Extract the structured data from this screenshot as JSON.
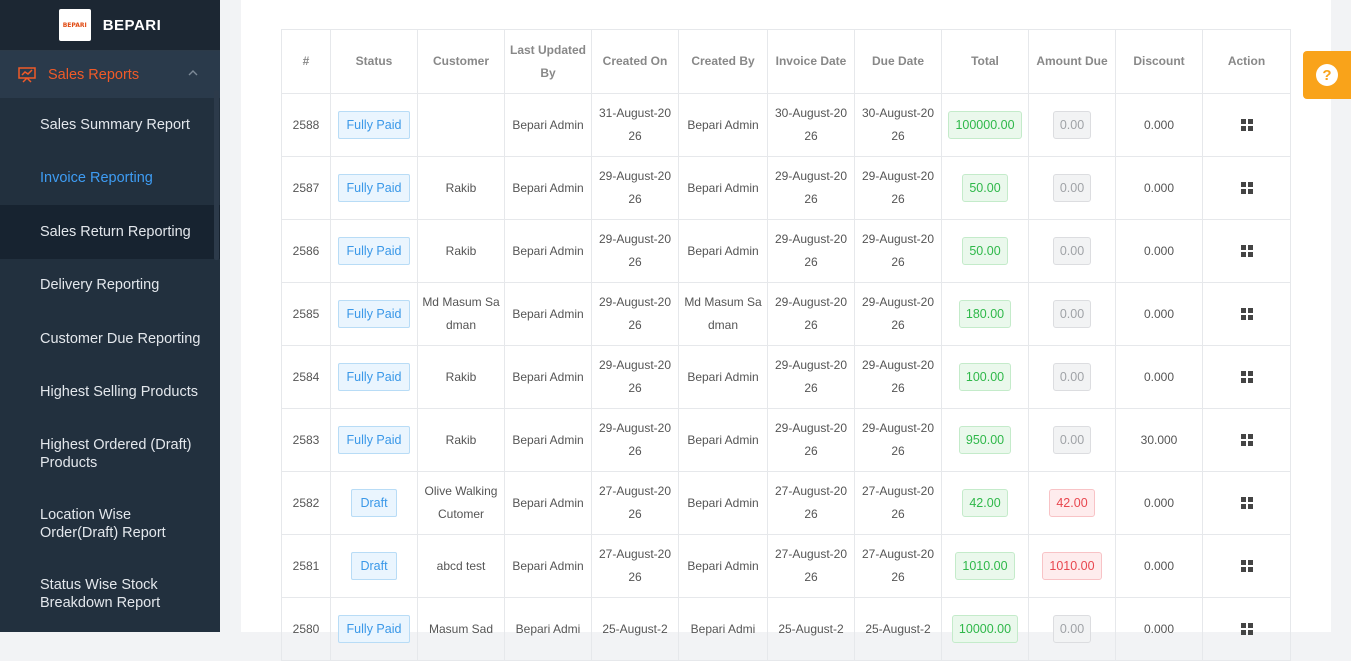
{
  "brand": {
    "name": "BEPARI",
    "logo_text": "BEPARI"
  },
  "sidebar": {
    "section_label": "Sales Reports",
    "items": [
      {
        "label": "Sales Summary Report"
      },
      {
        "label": "Invoice Reporting"
      },
      {
        "label": "Sales Return Reporting"
      },
      {
        "label": "Delivery Reporting"
      },
      {
        "label": "Customer Due Reporting"
      },
      {
        "label": "Highest Selling Products"
      },
      {
        "label": "Highest Ordered (Draft) Products"
      },
      {
        "label": "Location Wise Order(Draft) Report"
      },
      {
        "label": "Status Wise Stock Breakdown Report"
      }
    ]
  },
  "table": {
    "headers": [
      "#",
      "Status",
      "Customer",
      "Last Updated By",
      "Created On",
      "Created By",
      "Invoice Date",
      "Due Date",
      "Total",
      "Amount Due",
      "Discount",
      "Action"
    ],
    "rows": [
      {
        "id": "2588",
        "status": "Fully Paid",
        "customer": "",
        "last_updated_by": "Bepari Admin",
        "created_on": "31-August-2026",
        "created_by": "Bepari Admin",
        "invoice_date": "30-August-2026",
        "due_date": "30-August-2026",
        "total": "100000.00",
        "amount_due": "0.00",
        "due_state": "grey",
        "discount": "0.000"
      },
      {
        "id": "2587",
        "status": "Fully Paid",
        "customer": "Rakib",
        "last_updated_by": "Bepari Admin",
        "created_on": "29-August-2026",
        "created_by": "Bepari Admin",
        "invoice_date": "29-August-2026",
        "due_date": "29-August-2026",
        "total": "50.00",
        "amount_due": "0.00",
        "due_state": "grey",
        "discount": "0.000"
      },
      {
        "id": "2586",
        "status": "Fully Paid",
        "customer": "Rakib",
        "last_updated_by": "Bepari Admin",
        "created_on": "29-August-2026",
        "created_by": "Bepari Admin",
        "invoice_date": "29-August-2026",
        "due_date": "29-August-2026",
        "total": "50.00",
        "amount_due": "0.00",
        "due_state": "grey",
        "discount": "0.000"
      },
      {
        "id": "2585",
        "status": "Fully Paid",
        "customer": "Md Masum Sadman",
        "last_updated_by": "Bepari Admin",
        "created_on": "29-August-2026",
        "created_by": "Md Masum Sadman",
        "invoice_date": "29-August-2026",
        "due_date": "29-August-2026",
        "total": "180.00",
        "amount_due": "0.00",
        "due_state": "grey",
        "discount": "0.000"
      },
      {
        "id": "2584",
        "status": "Fully Paid",
        "customer": "Rakib",
        "last_updated_by": "Bepari Admin",
        "created_on": "29-August-2026",
        "created_by": "Bepari Admin",
        "invoice_date": "29-August-2026",
        "due_date": "29-August-2026",
        "total": "100.00",
        "amount_due": "0.00",
        "due_state": "grey",
        "discount": "0.000"
      },
      {
        "id": "2583",
        "status": "Fully Paid",
        "customer": "Rakib",
        "last_updated_by": "Bepari Admin",
        "created_on": "29-August-2026",
        "created_by": "Bepari Admin",
        "invoice_date": "29-August-2026",
        "due_date": "29-August-2026",
        "total": "950.00",
        "amount_due": "0.00",
        "due_state": "grey",
        "discount": "30.000"
      },
      {
        "id": "2582",
        "status": "Draft",
        "customer": "Olive Walking Cutomer",
        "last_updated_by": "Bepari Admin",
        "created_on": "27-August-2026",
        "created_by": "Bepari Admin",
        "invoice_date": "27-August-2026",
        "due_date": "27-August-2026",
        "total": "42.00",
        "amount_due": "42.00",
        "due_state": "red",
        "discount": "0.000"
      },
      {
        "id": "2581",
        "status": "Draft",
        "customer": "abcd test",
        "last_updated_by": "Bepari Admin",
        "created_on": "27-August-2026",
        "created_by": "Bepari Admin",
        "invoice_date": "27-August-2026",
        "due_date": "27-August-2026",
        "total": "1010.00",
        "amount_due": "1010.00",
        "due_state": "red",
        "discount": "0.000"
      },
      {
        "id": "2580",
        "status": "Fully Paid",
        "customer": "Masum Sad",
        "last_updated_by": "Bepari Admi",
        "created_on": "25-August-2",
        "created_by": "Bepari Admi",
        "invoice_date": "25-August-2",
        "due_date": "25-August-2",
        "total": "10000.00",
        "amount_due": "0.00",
        "due_state": "grey",
        "discount": "0.000"
      }
    ]
  },
  "help": {
    "label": "?"
  },
  "colors": {
    "accent": "#f05a28",
    "active_link": "#3e9cf3",
    "help_button": "#f9a31a"
  },
  "icons": {
    "section": "presentation-chart-icon",
    "chevron": "chevron-up-icon",
    "action": "grid-icon"
  }
}
